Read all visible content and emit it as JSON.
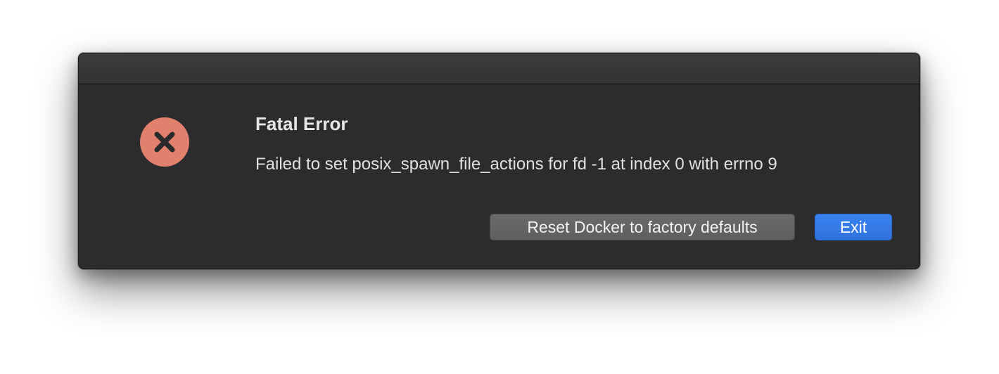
{
  "dialog": {
    "title": "Fatal Error",
    "message": "Failed to set posix_spawn_file_actions for fd -1 at index 0 with errno 9",
    "icon": "error-x-circle-icon",
    "icon_color": "#e2806e",
    "buttons": {
      "reset_label": "Reset Docker to factory defaults",
      "exit_label": "Exit"
    },
    "accent_color": "#2f72de"
  }
}
